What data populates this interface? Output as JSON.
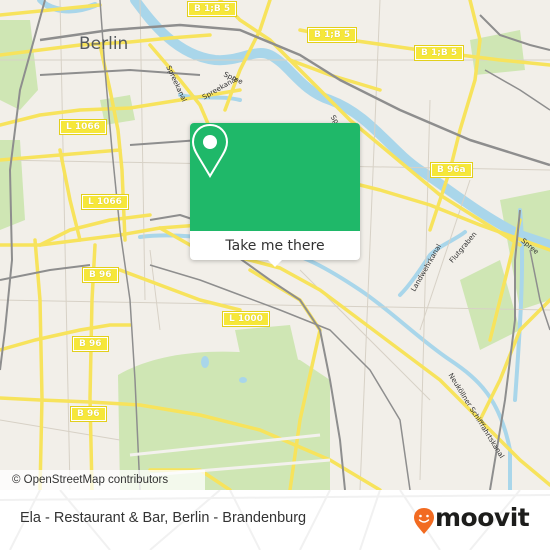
{
  "map": {
    "city_label": "Berlin",
    "road_shields": [
      "B 1;B 5",
      "B 1;B 5",
      "B 1;B 5",
      "L 1066",
      "L 1066",
      "B 96a",
      "B 96",
      "B 96",
      "B 96",
      "L 1000"
    ],
    "water_labels": [
      "Spreekanal",
      "Spreekanal",
      "Spree",
      "Spree",
      "Spree",
      "Landwehrkanal",
      "Flutgraben",
      "Neuköllner Schifffahrtskanal"
    ],
    "attribution": "© OpenStreetMap contributors",
    "colors": {
      "land": "#f2efe9",
      "water": "#a9d6ea",
      "park": "#cfe6b4",
      "road": "#f7e35c",
      "rail": "#8a8a8a"
    }
  },
  "popup": {
    "icon": "map-pin-icon",
    "button_label": "Take me there",
    "accent_color": "#1fb869"
  },
  "footer": {
    "place_name": "Ela - Restaurant & Bar, Berlin - Brandenburg",
    "brand": {
      "name": "moovit",
      "icon": "moovit-smiley-pin-icon",
      "accent_color": "#f26b21"
    }
  }
}
